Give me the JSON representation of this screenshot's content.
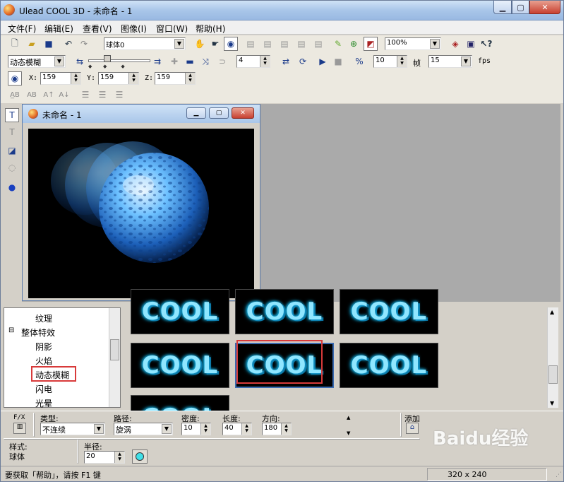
{
  "app": {
    "title": "Ulead COOL 3D - 未命名 - 1"
  },
  "menu": [
    "文件(F)",
    "编辑(E)",
    "查看(V)",
    "图像(I)",
    "窗口(W)",
    "帮助(H)"
  ],
  "toolbar1": {
    "object_select": "球体0",
    "zoom": "100%"
  },
  "toolbar2": {
    "effect_select": "动态模糊",
    "frame_value": "4",
    "rate_value": "10",
    "frame_label": "帧",
    "fps_value": "15",
    "fps_label": "fps"
  },
  "toolbar3": {
    "x_label": "X:",
    "x_value": "159",
    "y_label": "Y:",
    "y_value": "159",
    "z_label": "Z:",
    "z_value": "159"
  },
  "child_window": {
    "title": "未命名 - 1"
  },
  "tree": {
    "items": [
      "纹理",
      "整体特效",
      "阴影",
      "火焰",
      "动态模糊",
      "闪电",
      "光晕"
    ],
    "selected": "动态模糊"
  },
  "thumbnails": {
    "label": "COOL",
    "count": 7,
    "selected_index": 4
  },
  "attributes": {
    "fx_label": "F/X",
    "type_label": "类型:",
    "type_value": "不连续",
    "path_label": "路径:",
    "path_value": "旋涡",
    "density_label": "密度:",
    "density_value": "10",
    "length_label": "长度:",
    "length_value": "40",
    "direction_label": "方向:",
    "direction_value": "180",
    "add_label": "添加",
    "style_label": "样式:",
    "style_value": "球体",
    "radius_label": "半径:",
    "radius_value": "20"
  },
  "status": {
    "help_text": "要获取「帮助」，请按 F1 键",
    "dimensions": "320 x 240"
  },
  "watermark": {
    "text": "Baidu经验"
  },
  "colors": {
    "highlight": "#d83a3a",
    "titlebar": "#a9c6e9",
    "mdi_bg": "#aaaaaa",
    "sphere": "#3fa0f0"
  }
}
